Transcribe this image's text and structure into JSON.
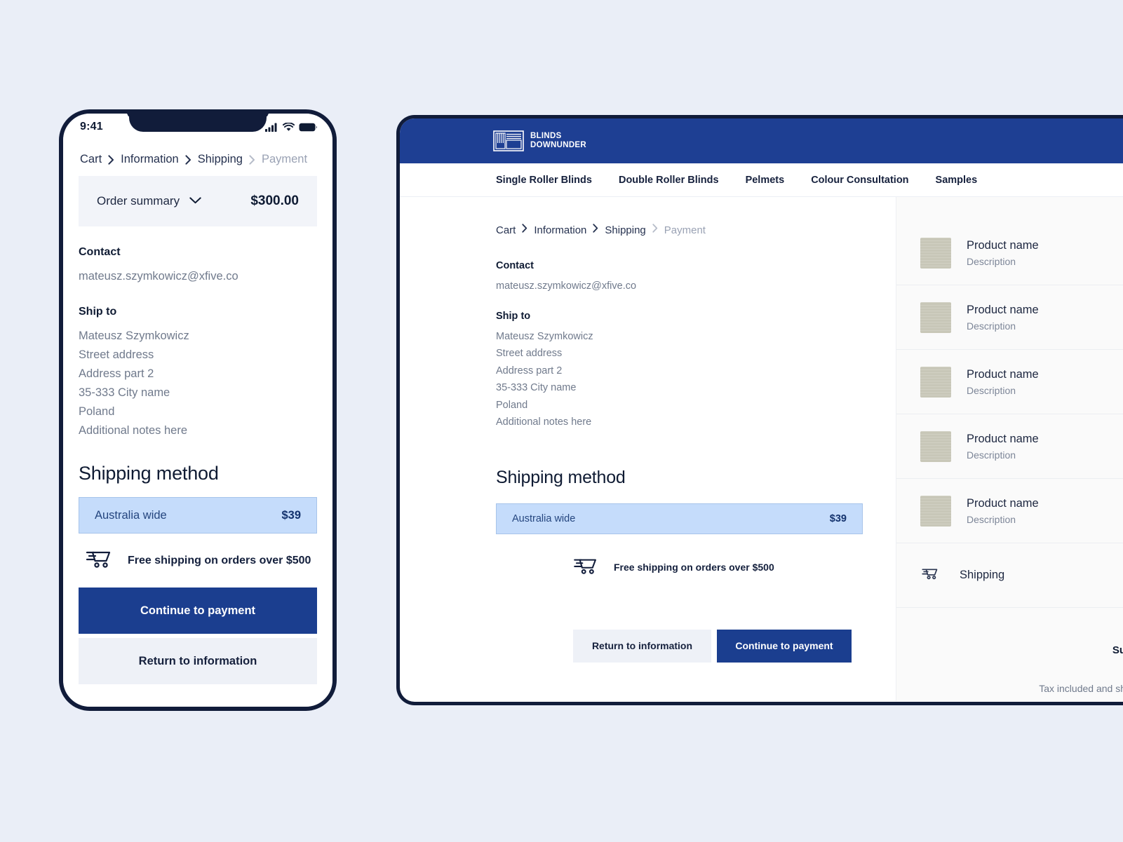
{
  "theme": {
    "page_bg": "#eaeef7",
    "brand_blue": "#1e3f93",
    "button_blue": "#1b3e8f",
    "frame_navy": "#111c3a",
    "selected_option_bg": "#c5dcfb",
    "thumbnail_color": "#c8c7b8"
  },
  "phone": {
    "status": {
      "time": "9:41",
      "signal_icon": "cellular-signal-icon",
      "wifi_icon": "wifi-icon",
      "battery_icon": "battery-icon"
    },
    "breadcrumb": [
      {
        "label": "Cart",
        "active": true
      },
      {
        "label": "Information",
        "active": true
      },
      {
        "label": "Shipping",
        "active": true
      },
      {
        "label": "Payment",
        "active": false
      }
    ],
    "order_summary": {
      "label": "Order summary",
      "chevron_icon": "chevron-down-icon",
      "total": "$300.00"
    },
    "contact": {
      "heading": "Contact",
      "email": "mateusz.szymkowicz@xfive.co"
    },
    "ship_to": {
      "heading": "Ship to",
      "lines": [
        "Mateusz Szymkowicz",
        "Street address",
        "Address part 2",
        "35-333 City name",
        "Poland",
        "Additional notes here"
      ]
    },
    "shipping_method": {
      "title": "Shipping method",
      "option_name": "Australia wide",
      "option_price": "$39",
      "free_shipping_icon": "shipping-cart-icon",
      "free_shipping_note": "Free shipping on orders over $500"
    },
    "actions": {
      "primary": "Continue to payment",
      "secondary": "Return to information"
    }
  },
  "desktop": {
    "brand": {
      "logo_icon": "blinds-window-logo-icon",
      "name_line1": "BLINDS",
      "name_line2": "DOWNUNDER"
    },
    "nav": [
      "Single Roller Blinds",
      "Double Roller Blinds",
      "Pelmets",
      "Colour Consultation",
      "Samples"
    ],
    "breadcrumb": [
      {
        "label": "Cart",
        "active": true
      },
      {
        "label": "Information",
        "active": true
      },
      {
        "label": "Shipping",
        "active": true
      },
      {
        "label": "Payment",
        "active": false
      }
    ],
    "contact": {
      "heading": "Contact",
      "email": "mateusz.szymkowicz@xfive.co"
    },
    "ship_to": {
      "heading": "Ship to",
      "lines": [
        "Mateusz Szymkowicz",
        "Street address",
        "Address part 2",
        "35-333 City name",
        "Poland",
        "Additional notes here"
      ]
    },
    "shipping_method": {
      "title": "Shipping method",
      "option_name": "Australia wide",
      "option_price": "$39",
      "free_shipping_icon": "shipping-cart-icon",
      "free_shipping_note": "Free shipping on orders over $500"
    },
    "actions": {
      "secondary": "Return to information",
      "primary": "Continue to payment"
    },
    "sidebar": {
      "products": [
        {
          "name": "Product name",
          "description": "Description"
        },
        {
          "name": "Product name",
          "description": "Description"
        },
        {
          "name": "Product name",
          "description": "Description"
        },
        {
          "name": "Product name",
          "description": "Description"
        },
        {
          "name": "Product name",
          "description": "Description"
        }
      ],
      "shipping_row": {
        "icon": "shipping-cart-icon",
        "label": "Shipping"
      },
      "subtotal_label_clipped": "Su",
      "tax_note_clipped": "Tax included and sh"
    }
  }
}
